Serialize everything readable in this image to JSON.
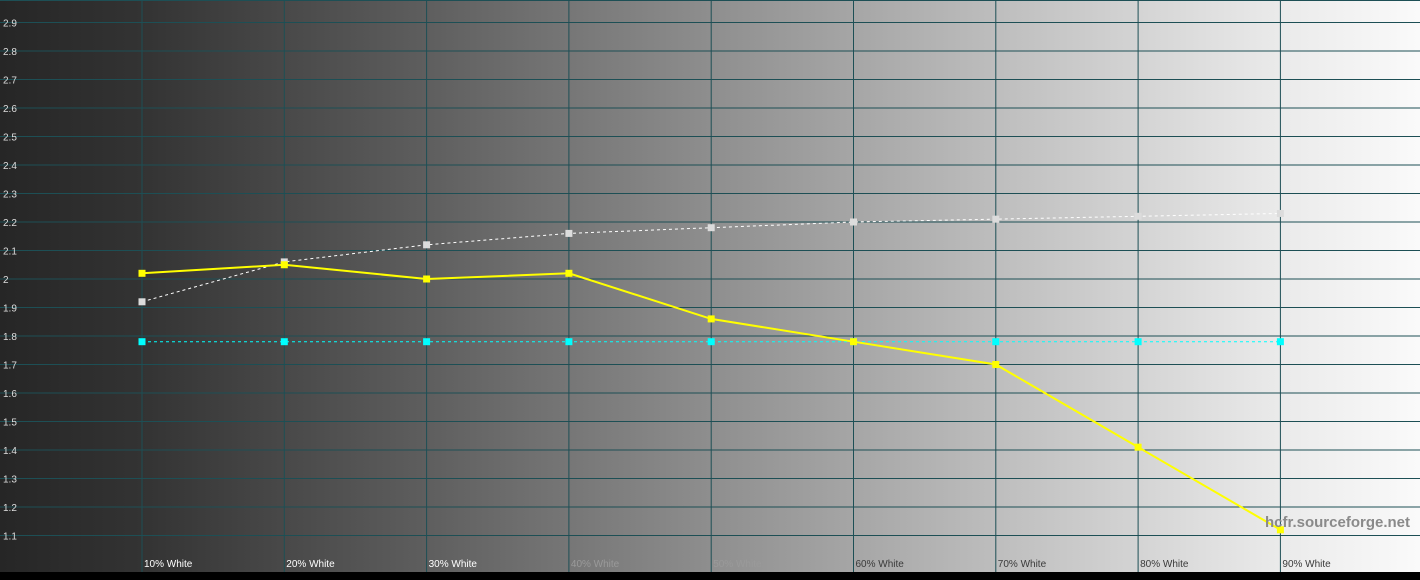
{
  "chart_data": {
    "type": "line",
    "title": "",
    "xlabel": "",
    "ylabel": "",
    "categories": [
      "10% White",
      "20% White",
      "30% White",
      "40% White",
      "50% White",
      "60% White",
      "70% White",
      "80% White",
      "90% White"
    ],
    "yticks": [
      "1.1",
      "1.2",
      "1.3",
      "1.4",
      "1.5",
      "1.6",
      "1.7",
      "1.8",
      "1.9",
      "2",
      "2.1",
      "2.2",
      "2.3",
      "2.4",
      "2.5",
      "2.6",
      "2.7",
      "2.8",
      "2.9"
    ],
    "ylim": [
      1.05,
      3.0
    ],
    "grid": true,
    "background": "gradient dark-gray to white",
    "watermark": "hcfr.sourceforge.net",
    "series": [
      {
        "color": "#ffff00",
        "line_style": "solid",
        "values": [
          2.02,
          2.05,
          2.0,
          2.02,
          1.86,
          1.78,
          1.7,
          1.41,
          1.12
        ]
      },
      {
        "color": "#ffffff",
        "line_style": "dashed",
        "values": [
          1.92,
          2.06,
          2.12,
          2.16,
          2.18,
          2.2,
          2.21,
          2.22,
          2.23
        ]
      },
      {
        "color": "#00ffff",
        "line_style": "dashed",
        "values": [
          1.78,
          1.78,
          1.78,
          1.78,
          1.78,
          1.78,
          1.78,
          1.78,
          1.78
        ]
      }
    ]
  }
}
